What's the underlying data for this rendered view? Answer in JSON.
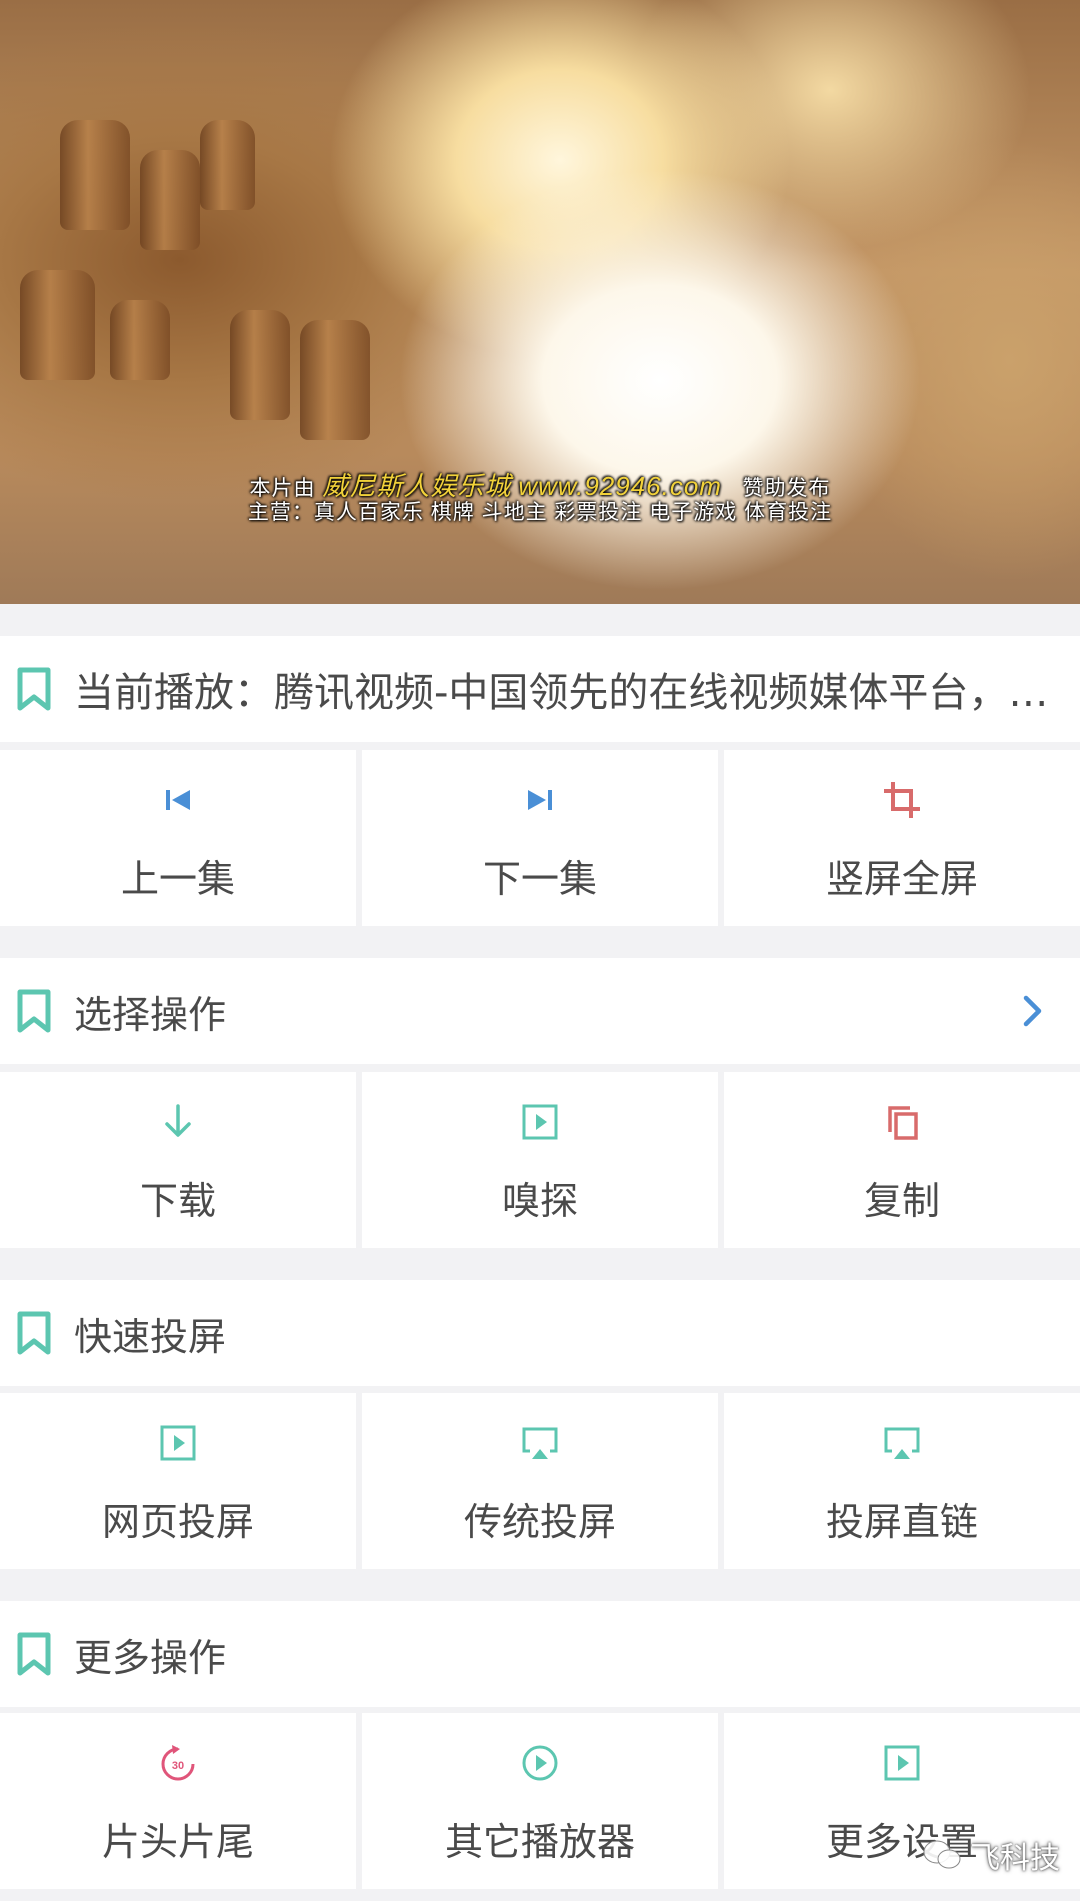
{
  "video": {
    "subtitle": {
      "line1_prefix": "本片由",
      "line1_brand": "威尼斯人娱乐城",
      "line1_url": "www.92946.com",
      "line1_suffix": "赞助发布",
      "line2": "主营：真人百家乐 棋牌 斗地主 彩票投注 电子游戏 体育投注"
    }
  },
  "now_playing": {
    "text": "当前播放：腾讯视频-中国领先的在线视频媒体平台，…"
  },
  "playback": [
    {
      "label": "上一集",
      "icon": "skip-previous-icon"
    },
    {
      "label": "下一集",
      "icon": "skip-next-icon"
    },
    {
      "label": "竖屏全屏",
      "icon": "crop-icon"
    }
  ],
  "select_ops": {
    "title": "选择操作",
    "items": [
      {
        "label": "下载",
        "icon": "download-icon"
      },
      {
        "label": "嗅探",
        "icon": "play-square-icon"
      },
      {
        "label": "复制",
        "icon": "copy-icon"
      }
    ]
  },
  "quick_cast": {
    "title": "快速投屏",
    "items": [
      {
        "label": "网页投屏",
        "icon": "play-square-icon"
      },
      {
        "label": "传统投屏",
        "icon": "airplay-icon"
      },
      {
        "label": "投屏直链",
        "icon": "airplay-icon"
      }
    ]
  },
  "more_ops": {
    "title": "更多操作",
    "items": [
      {
        "label": "片头片尾",
        "icon": "replay-30-icon",
        "badge": "30"
      },
      {
        "label": "其它播放器",
        "icon": "play-circle-icon"
      },
      {
        "label": "更多设置",
        "icon": "play-square-icon"
      }
    ]
  },
  "watermark": {
    "text": "飞科技"
  },
  "colors": {
    "teal": "#5cc6b0",
    "blue": "#4a8fd6",
    "red": "#d86b6b",
    "pink": "#e0557a",
    "text": "#4a4a4a",
    "divider": "#f2f2f4"
  }
}
